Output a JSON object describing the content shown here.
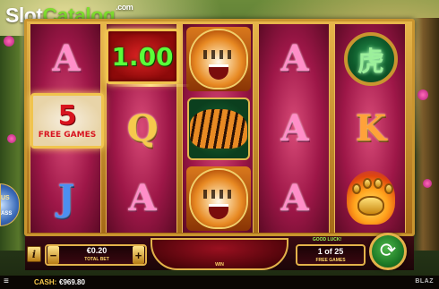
{
  "brand": {
    "part1": "Slot",
    "part2": "Catalog",
    "suffix": ".com"
  },
  "reels": [
    [
      "A",
      "1.00",
      "J"
    ],
    [
      "",
      "Q",
      "A"
    ],
    [
      "tiger",
      "walking-tiger",
      "tiger"
    ],
    [
      "A",
      "A",
      "A"
    ],
    [
      "medallion",
      "K",
      "paw"
    ]
  ],
  "medallion_glyph": "虎",
  "multiplier": {
    "value": "1.00"
  },
  "free_games_symbol": {
    "number": "5",
    "label": "FREE GAMES"
  },
  "side_badge": {
    "top": "US",
    "bottom": "ASS"
  },
  "controls": {
    "info": "i",
    "minus": "−",
    "plus": "+",
    "total_bet_value": "€0.20",
    "total_bet_label": "TOTAL BET",
    "win_label": "WIN",
    "good_luck": "GOOD LUCK!",
    "free_games_count": "1 of 25",
    "free_games_label": "FREE GAMES",
    "spin_icon": "spin-arrows-icon"
  },
  "status": {
    "menu_icon": "≡",
    "cash_label": "CASH:",
    "cash_value": "€969.80",
    "provider": "BLAZ"
  },
  "colors": {
    "frame_gold": "#c9952f",
    "reel_red": "#9e1748",
    "multiplier_green": "#5aff3a",
    "free_games_red": "#d8141f",
    "spin_green": "#1d7a26"
  }
}
